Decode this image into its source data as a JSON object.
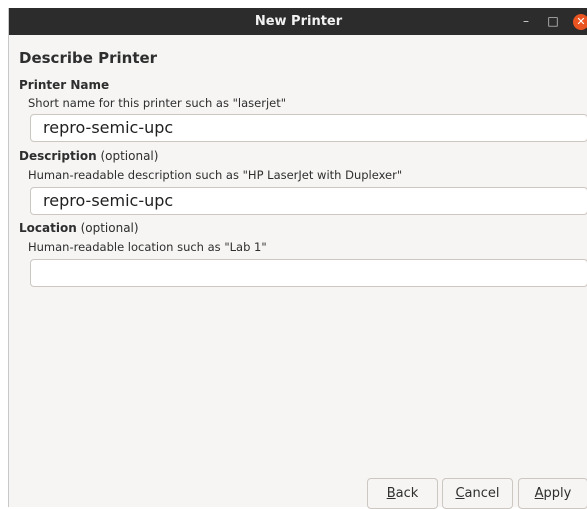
{
  "window": {
    "title": "New Printer",
    "minimize_glyph": "–",
    "maximize_glyph": "□",
    "close_glyph": "✕"
  },
  "heading": "Describe Printer",
  "printer_name": {
    "label": "Printer Name",
    "hint": "Short name for this printer such as \"laserjet\"",
    "value": "repro-semic-upc"
  },
  "description": {
    "label": "Description",
    "optional": " (optional)",
    "hint": "Human-readable description such as \"HP LaserJet with Duplexer\"",
    "value": "repro-semic-upc"
  },
  "location": {
    "label": "Location",
    "optional": " (optional)",
    "hint": "Human-readable location such as \"Lab 1\"",
    "value": ""
  },
  "buttons": {
    "back": {
      "mnemonic": "B",
      "rest": "ack"
    },
    "cancel": {
      "mnemonic": "C",
      "rest": "ancel"
    },
    "apply": {
      "mnemonic": "A",
      "rest": "pply"
    }
  },
  "colors": {
    "titlebar": "#2c2c2c",
    "close": "#e95420",
    "background": "#f6f5f4"
  }
}
